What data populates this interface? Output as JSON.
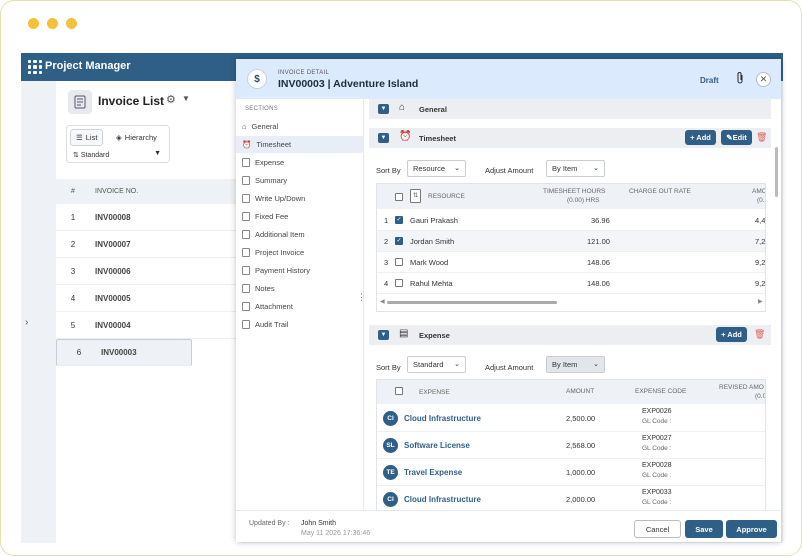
{
  "app": {
    "title": "Project Manager"
  },
  "list": {
    "title": "Invoice List",
    "tabs": [
      "List",
      "Hierarchy"
    ],
    "view_select": "Standard",
    "columns": [
      "#",
      "INVOICE NO."
    ],
    "rows": [
      {
        "n": "1",
        "inv": "INV00008"
      },
      {
        "n": "2",
        "inv": "INV00007"
      },
      {
        "n": "3",
        "inv": "INV00006"
      },
      {
        "n": "4",
        "inv": "INV00005"
      },
      {
        "n": "5",
        "inv": "INV00004"
      },
      {
        "n": "6",
        "inv": "INV00003"
      }
    ]
  },
  "detail": {
    "label": "INVOICE DETAIL",
    "title": "INV00003 | Adventure Island",
    "status": "Draft",
    "sections_label": "SECTIONS",
    "sections": [
      "General",
      "Timesheet",
      "Expense",
      "Summary",
      "Write Up/Down",
      "Fixed Fee",
      "Additional Item",
      "Project Invoice",
      "Payment History",
      "Notes",
      "Attachment",
      "Audit Trail"
    ],
    "general_header": "General",
    "timesheet": {
      "header": "Timesheet",
      "add_label": "+ Add",
      "edit_label": "Edit",
      "sort_by_label": "Sort By",
      "sort_by_value": "Resource",
      "adjust_label": "Adjust Amount",
      "adjust_value": "By Item",
      "col_resource": "RESOURCE",
      "col_hours_1": "TIMESHEET HOURS",
      "col_hours_2": "(0.00) HRS",
      "col_rate": "CHARGE OUT RATE",
      "col_amount_1": "AMO",
      "col_amount_2": "(0.",
      "rows": [
        {
          "n": "1",
          "checked": true,
          "name": "Gauri Prakash",
          "hours": "36.96",
          "amount": "4,4"
        },
        {
          "n": "2",
          "checked": true,
          "name": "Jordan Smith",
          "hours": "121.00",
          "amount": "7,2"
        },
        {
          "n": "3",
          "checked": false,
          "name": "Mark Wood",
          "hours": "148.06",
          "amount": "9,2"
        },
        {
          "n": "4",
          "checked": false,
          "name": "Rahul Mehta",
          "hours": "148.06",
          "amount": "9,2"
        }
      ]
    },
    "expense": {
      "header": "Expense",
      "add_label": "+ Add",
      "sort_by_label": "Sort By",
      "sort_by_value": "Standard",
      "adjust_label": "Adjust Amount",
      "adjust_value": "By Item",
      "col_expense": "EXPENSE",
      "col_amount": "AMOUNT",
      "col_code": "EXPENSE CODE",
      "col_revised_1": "REVISED AMO",
      "col_revised_2": "(0.0",
      "gl_label": "GL Code :",
      "rows": [
        {
          "abbr": "CI",
          "name": "Cloud Infrastructure",
          "amount": "2,500.00",
          "code": "EXP0026"
        },
        {
          "abbr": "SL",
          "name": "Software License",
          "amount": "2,568.00",
          "code": "EXP0027"
        },
        {
          "abbr": "TE",
          "name": "Travel Expense",
          "amount": "1,000.00",
          "code": "EXP0028"
        },
        {
          "abbr": "CI",
          "name": "Cloud Infrastructure",
          "amount": "2,000.00",
          "code": "EXP0033"
        }
      ]
    },
    "footer": {
      "updated_by_label": "Updated By :",
      "updated_by_name": "John Smith",
      "updated_date": "May 11 2026 17:36:46",
      "cancel": "Cancel",
      "save": "Save",
      "approve": "Approve"
    }
  },
  "colors": {
    "primary": "#2f5f86",
    "header_bg": "#dceafd",
    "accent_dots": "#f5c03a"
  }
}
